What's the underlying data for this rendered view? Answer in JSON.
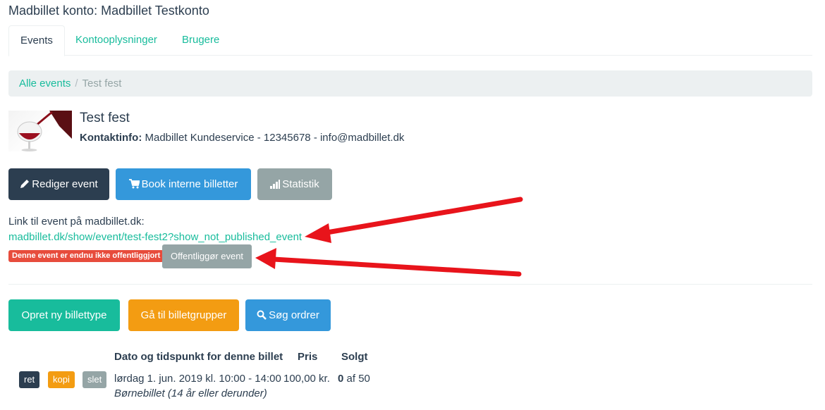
{
  "header": {
    "title": "Madbillet konto: Madbillet Testkonto"
  },
  "tabs": [
    {
      "label": "Events",
      "active": true
    },
    {
      "label": "Kontooplysninger",
      "active": false
    },
    {
      "label": "Brugere",
      "active": false
    }
  ],
  "breadcrumb": {
    "link": "Alle events",
    "separator": "/",
    "current": "Test fest"
  },
  "event": {
    "name": "Test fest",
    "contact_label": "Kontaktinfo:",
    "contact_value": " Madbillet Kundeservice - 12345678 - info@madbillet.dk"
  },
  "actions": {
    "edit": "Rediger event",
    "book": "Book interne billetter",
    "stats": "Statistik"
  },
  "link_section": {
    "label": "Link til event på madbillet.dk:",
    "url": "madbillet.dk/show/event/test-fest2?show_not_published_event",
    "unpublished_badge": "Denne event er endnu ikke offentliggjort",
    "publish_button": "Offentliggør event"
  },
  "ticket_actions": {
    "create": "Opret ny billettype",
    "groups": "Gå til billetgrupper",
    "search": "Søg ordrer"
  },
  "table": {
    "headers": {
      "datetime": "Dato og tidspunkt for denne billet",
      "price": "Pris",
      "sold": "Solgt"
    },
    "rows": [
      {
        "edit": "ret",
        "copy": "kopi",
        "delete": "slet",
        "datetime": "lørdag 1. jun. 2019 kl. 10:00 - 14:00",
        "price": "100,00 kr.",
        "sold_count": "0",
        "sold_of": " af 50",
        "name": "Børnebillet (14 år eller derunder)"
      }
    ]
  },
  "colors": {
    "primary_dark": "#2c3e50",
    "teal": "#18bc9c",
    "blue": "#3498db",
    "gray": "#95a5a6",
    "orange": "#f39c12",
    "red": "#e74c3c",
    "annotation_arrow": "#e8141b"
  },
  "icons": {
    "edit": "pencil-icon",
    "book": "cart-icon",
    "stats": "bar-chart-icon",
    "search": "search-icon"
  }
}
